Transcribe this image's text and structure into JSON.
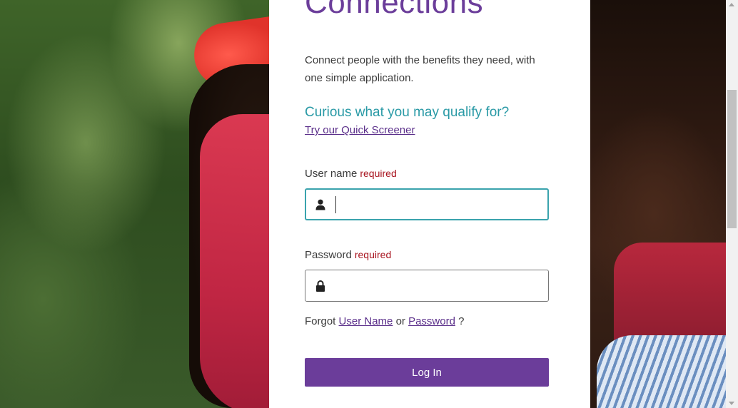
{
  "brand": {
    "title": "Connections"
  },
  "intro": "Connect people with the benefits they need, with one simple application.",
  "screener": {
    "prompt": "Curious what you may qualify for?",
    "link_label": "Try our Quick Screener"
  },
  "username": {
    "label": "User name",
    "required": "required",
    "value": "",
    "icon": "user-icon"
  },
  "password": {
    "label": "Password",
    "required": "required",
    "value": "",
    "icon": "lock-icon"
  },
  "forgot": {
    "prefix": "Forgot",
    "username_link": "User Name",
    "or": "or",
    "password_link": "Password",
    "suffix": "?"
  },
  "login_button": "Log In",
  "colors": {
    "brand_purple": "#6b3d9a",
    "teal": "#2a9aa6",
    "required_red": "#a8141f",
    "focus_border": "#3aa3ad"
  }
}
